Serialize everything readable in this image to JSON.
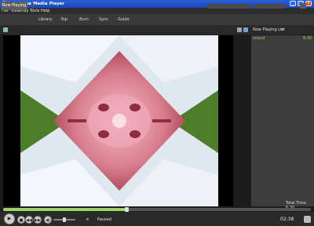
{
  "titlebar": {
    "title": "Windows Media Player",
    "min": "_",
    "max": "□",
    "close": "x"
  },
  "menu": {
    "items": [
      "File",
      "View",
      "Play",
      "Tools",
      "Help"
    ]
  },
  "taskbar": {
    "now_playing": "Now Playing",
    "now_playing_arrow": "▾",
    "tasks": [
      "Library",
      "Rip",
      "Burn",
      "Sync",
      "Guide"
    ]
  },
  "toolbar": {
    "playlist_dropdown": "Now Playing List",
    "playlist_arrow": "▾"
  },
  "playlist": {
    "items": [
      {
        "title": "sound",
        "duration": "6:30"
      }
    ],
    "total_time": "Total Time: 6:30"
  },
  "playback": {
    "progress": 0.4,
    "volume": 0.5,
    "status": "Paused",
    "elapsed": "02:38",
    "play_symbol": "▶",
    "stop_symbol": "■",
    "prev_symbol": "◀◀",
    "next_symbol": "▶▶",
    "mute_symbol": "◀)",
    "pause_symbol": "⏸"
  },
  "colors": {
    "titlebar": "#2a5fd6",
    "accent_green": "#8bdc5a",
    "panel": "#3d3d3d"
  },
  "icons": [
    "app-icon",
    "view-icon",
    "speaker-icon",
    "shuffle-icon",
    "fullscreen-icon"
  ]
}
